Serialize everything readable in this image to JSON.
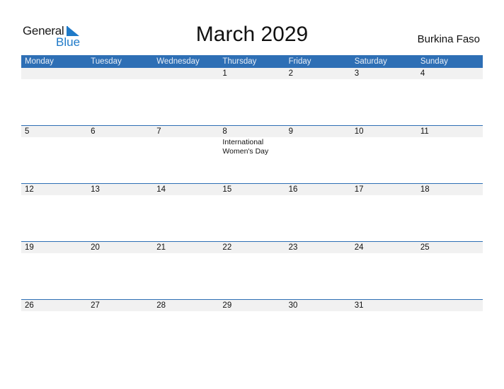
{
  "logo": {
    "general": "General",
    "blue": "Blue"
  },
  "title": "March 2029",
  "country": "Burkina Faso",
  "colors": {
    "accent": "#2e6fb5",
    "strip": "#f1f1f1",
    "logo_blue": "#1f7ac8"
  },
  "weekdays": [
    "Monday",
    "Tuesday",
    "Wednesday",
    "Thursday",
    "Friday",
    "Saturday",
    "Sunday"
  ],
  "weeks": [
    {
      "days": [
        "",
        "",
        "",
        "1",
        "2",
        "3",
        "4"
      ],
      "events": [
        "",
        "",
        "",
        "",
        "",
        "",
        ""
      ]
    },
    {
      "days": [
        "5",
        "6",
        "7",
        "8",
        "9",
        "10",
        "11"
      ],
      "events": [
        "",
        "",
        "",
        "International Women's Day",
        "",
        "",
        ""
      ]
    },
    {
      "days": [
        "12",
        "13",
        "14",
        "15",
        "16",
        "17",
        "18"
      ],
      "events": [
        "",
        "",
        "",
        "",
        "",
        "",
        ""
      ]
    },
    {
      "days": [
        "19",
        "20",
        "21",
        "22",
        "23",
        "24",
        "25"
      ],
      "events": [
        "",
        "",
        "",
        "",
        "",
        "",
        ""
      ]
    },
    {
      "days": [
        "26",
        "27",
        "28",
        "29",
        "30",
        "31",
        ""
      ],
      "events": [
        "",
        "",
        "",
        "",
        "",
        "",
        ""
      ]
    }
  ]
}
